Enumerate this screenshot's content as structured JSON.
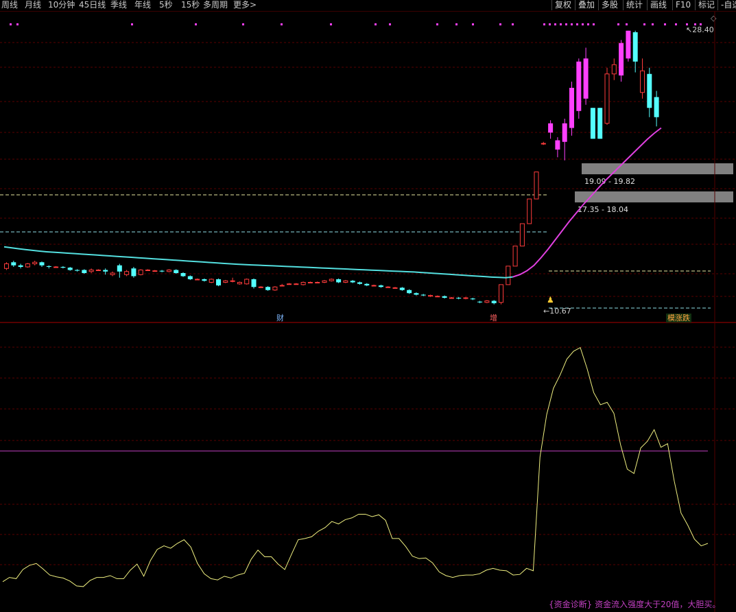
{
  "toolbar": {
    "tabs": [
      "周线",
      "月线",
      "10分钟",
      "45日线",
      "季线",
      "年线",
      "5秒",
      "15秒",
      "多周期",
      "更多>"
    ],
    "buttons": [
      "复权",
      "叠加",
      "多股",
      "统计",
      "画线",
      "F10",
      "标记",
      "-自选"
    ]
  },
  "colors": {
    "up": "#ff3c3c",
    "down": "#54ffff",
    "limit_up": "#ff40ff",
    "ma": "#54e0e0",
    "ma_up": "#e040e0",
    "indicator": "#f0f080",
    "threshold": "#c040c0"
  },
  "labels": {
    "high_price": "28.40",
    "low_price": "10.67",
    "zone1": "19.09 - 19.82",
    "zone2": "17.35 - 18.04",
    "event_cai": "财",
    "event_zeng": "增",
    "event_zhangdie": "模涨跌",
    "footer": "{资金诊断} 资金流入强度大于20值，大胆买。"
  },
  "chart_data": [
    {
      "type": "candlestick",
      "price_range": [
        9.5,
        29.5
      ],
      "marked_high": 28.4,
      "marked_low": 10.67,
      "resistance_zones": [
        [
          19.09,
          19.82
        ],
        [
          17.35,
          18.04
        ]
      ],
      "candles": [
        {
          "o": 13.0,
          "c": 13.3,
          "h": 13.4,
          "l": 12.9
        },
        {
          "o": 13.4,
          "c": 13.2,
          "h": 13.5,
          "l": 13.1
        },
        {
          "o": 13.2,
          "c": 13.1,
          "h": 13.3,
          "l": 13.0
        },
        {
          "o": 13.1,
          "c": 13.3,
          "h": 13.35,
          "l": 13.05
        },
        {
          "o": 13.3,
          "c": 13.4,
          "h": 13.5,
          "l": 13.2
        },
        {
          "o": 13.4,
          "c": 13.2,
          "h": 13.45,
          "l": 13.1
        },
        {
          "o": 13.15,
          "c": 13.1,
          "h": 13.2,
          "l": 13.0
        },
        {
          "o": 13.1,
          "c": 13.1,
          "h": 13.15,
          "l": 13.05
        },
        {
          "o": 13.1,
          "c": 13.05,
          "h": 13.15,
          "l": 13.0
        },
        {
          "o": 13.05,
          "c": 12.9,
          "h": 13.1,
          "l": 12.85
        },
        {
          "o": 12.9,
          "c": 12.85,
          "h": 12.95,
          "l": 12.8
        },
        {
          "o": 12.9,
          "c": 12.7,
          "h": 12.95,
          "l": 12.65
        },
        {
          "o": 12.8,
          "c": 12.9,
          "h": 13.0,
          "l": 12.7
        },
        {
          "o": 12.9,
          "c": 12.9,
          "h": 12.95,
          "l": 12.85
        },
        {
          "o": 12.9,
          "c": 12.8,
          "h": 13.0,
          "l": 12.6
        },
        {
          "o": 12.6,
          "c": 12.7,
          "h": 12.8,
          "l": 12.5
        },
        {
          "o": 13.2,
          "c": 12.8,
          "h": 13.3,
          "l": 12.4
        },
        {
          "o": 12.6,
          "c": 12.8,
          "h": 12.9,
          "l": 12.5
        },
        {
          "o": 13.0,
          "c": 12.5,
          "h": 13.1,
          "l": 12.4
        },
        {
          "o": 12.6,
          "c": 12.9,
          "h": 12.95,
          "l": 12.55
        },
        {
          "o": 12.9,
          "c": 12.9,
          "h": 12.95,
          "l": 12.85
        },
        {
          "o": 12.85,
          "c": 12.85,
          "h": 12.9,
          "l": 12.8
        },
        {
          "o": 12.85,
          "c": 12.8,
          "h": 12.9,
          "l": 12.75
        },
        {
          "o": 12.8,
          "c": 12.9,
          "h": 12.95,
          "l": 12.75
        },
        {
          "o": 12.9,
          "c": 12.7,
          "h": 12.95,
          "l": 12.65
        },
        {
          "o": 12.7,
          "c": 12.5,
          "h": 12.75,
          "l": 12.45
        },
        {
          "o": 12.5,
          "c": 12.3,
          "h": 12.55,
          "l": 12.25
        },
        {
          "o": 12.3,
          "c": 12.3,
          "h": 12.35,
          "l": 12.25
        },
        {
          "o": 12.3,
          "c": 12.2,
          "h": 12.35,
          "l": 12.15
        },
        {
          "o": 12.1,
          "c": 12.3,
          "h": 12.35,
          "l": 12.05
        },
        {
          "o": 12.3,
          "c": 11.9,
          "h": 12.35,
          "l": 11.85
        },
        {
          "o": 12.1,
          "c": 12.2,
          "h": 12.25,
          "l": 12.05
        },
        {
          "o": 12.2,
          "c": 12.2,
          "h": 12.4,
          "l": 12.1
        },
        {
          "o": 12.0,
          "c": 12.1,
          "h": 12.15,
          "l": 11.95
        },
        {
          "o": 12.0,
          "c": 12.3,
          "h": 12.35,
          "l": 11.95
        },
        {
          "o": 12.3,
          "c": 11.8,
          "h": 12.35,
          "l": 11.7
        },
        {
          "o": 11.8,
          "c": 11.8,
          "h": 11.85,
          "l": 11.75
        },
        {
          "o": 11.8,
          "c": 11.6,
          "h": 11.85,
          "l": 11.55
        },
        {
          "o": 11.6,
          "c": 11.8,
          "h": 11.85,
          "l": 11.55
        },
        {
          "o": 11.9,
          "c": 11.9,
          "h": 12.0,
          "l": 11.85
        },
        {
          "o": 12.0,
          "c": 12.0,
          "h": 12.05,
          "l": 11.95
        },
        {
          "o": 12.0,
          "c": 12.0,
          "h": 12.05,
          "l": 11.95
        },
        {
          "o": 11.95,
          "c": 12.1,
          "h": 12.15,
          "l": 11.9
        },
        {
          "o": 12.1,
          "c": 12.1,
          "h": 12.15,
          "l": 12.05
        },
        {
          "o": 12.1,
          "c": 12.1,
          "h": 12.15,
          "l": 12.05
        },
        {
          "o": 12.1,
          "c": 12.2,
          "h": 12.25,
          "l": 12.05
        },
        {
          "o": 12.2,
          "c": 12.3,
          "h": 12.35,
          "l": 12.15
        },
        {
          "o": 12.3,
          "c": 12.1,
          "h": 12.35,
          "l": 12.05
        },
        {
          "o": 12.1,
          "c": 12.2,
          "h": 12.25,
          "l": 12.05
        },
        {
          "o": 12.2,
          "c": 12.1,
          "h": 12.25,
          "l": 12.05
        },
        {
          "o": 12.1,
          "c": 12.0,
          "h": 12.15,
          "l": 11.95
        },
        {
          "o": 12.0,
          "c": 11.9,
          "h": 12.05,
          "l": 11.85
        },
        {
          "o": 11.9,
          "c": 11.9,
          "h": 11.95,
          "l": 11.85
        },
        {
          "o": 11.9,
          "c": 11.8,
          "h": 11.95,
          "l": 11.75
        },
        {
          "o": 11.8,
          "c": 11.8,
          "h": 11.85,
          "l": 11.75
        },
        {
          "o": 11.75,
          "c": 11.75,
          "h": 11.8,
          "l": 11.7
        },
        {
          "o": 11.75,
          "c": 11.6,
          "h": 11.8,
          "l": 11.55
        },
        {
          "o": 11.6,
          "c": 11.4,
          "h": 11.65,
          "l": 11.35
        },
        {
          "o": 11.4,
          "c": 11.3,
          "h": 11.45,
          "l": 11.25
        },
        {
          "o": 11.3,
          "c": 11.25,
          "h": 11.35,
          "l": 11.2
        },
        {
          "o": 11.2,
          "c": 11.25,
          "h": 11.3,
          "l": 11.15
        },
        {
          "o": 11.2,
          "c": 11.2,
          "h": 11.25,
          "l": 11.15
        },
        {
          "o": 11.2,
          "c": 11.1,
          "h": 11.25,
          "l": 11.05
        },
        {
          "o": 11.1,
          "c": 11.1,
          "h": 11.15,
          "l": 11.05
        },
        {
          "o": 11.1,
          "c": 11.05,
          "h": 11.15,
          "l": 11.0
        },
        {
          "o": 11.05,
          "c": 11.1,
          "h": 11.15,
          "l": 11.0
        },
        {
          "o": 11.05,
          "c": 11.0,
          "h": 11.1,
          "l": 10.95
        },
        {
          "o": 10.85,
          "c": 10.8,
          "h": 10.9,
          "l": 10.75
        },
        {
          "o": 10.8,
          "c": 10.9,
          "h": 10.95,
          "l": 10.75
        },
        {
          "o": 10.9,
          "c": 10.75,
          "h": 10.95,
          "l": 10.67
        },
        {
          "o": 10.8,
          "c": 11.95,
          "h": 11.95,
          "l": 10.67
        },
        {
          "o": 11.95,
          "c": 13.15,
          "h": 13.15,
          "l": 11.95
        },
        {
          "o": 13.15,
          "c": 14.45,
          "h": 14.45,
          "l": 13.15
        },
        {
          "o": 14.45,
          "c": 15.9,
          "h": 15.9,
          "l": 14.45
        },
        {
          "o": 15.9,
          "c": 17.5,
          "h": 17.5,
          "l": 15.9
        },
        {
          "o": 17.5,
          "c": 19.25,
          "h": 19.25,
          "l": 17.5
        },
        {
          "o": 21.1,
          "c": 21.1,
          "h": 21.2,
          "l": 21.0
        },
        {
          "o": 22.4,
          "c": 21.8,
          "h": 22.6,
          "l": 21.4
        },
        {
          "o": 20.7,
          "c": 21.3,
          "h": 21.5,
          "l": 20.2
        },
        {
          "o": 21.2,
          "c": 22.4,
          "h": 22.7,
          "l": 20.0
        },
        {
          "o": 22.1,
          "c": 24.7,
          "h": 25.1,
          "l": 21.6
        },
        {
          "o": 23.2,
          "c": 26.4,
          "h": 26.6,
          "l": 22.7
        },
        {
          "o": 24.0,
          "c": 26.6,
          "h": 27.3,
          "l": 23.6
        },
        {
          "o": 23.4,
          "c": 21.4,
          "h": 23.4,
          "l": 21.4
        },
        {
          "o": 23.4,
          "c": 21.4,
          "h": 23.4,
          "l": 21.4
        },
        {
          "o": 22.4,
          "c": 25.6,
          "h": 26.0,
          "l": 22.3
        },
        {
          "o": 25.6,
          "c": 26.2,
          "h": 26.6,
          "l": 25.2
        },
        {
          "o": 25.5,
          "c": 27.6,
          "h": 27.8,
          "l": 25.1
        },
        {
          "o": 26.6,
          "c": 28.4,
          "h": 28.4,
          "l": 26.4
        },
        {
          "o": 28.3,
          "c": 26.4,
          "h": 28.4,
          "l": 25.7
        },
        {
          "o": 24.4,
          "c": 25.8,
          "h": 26.6,
          "l": 24.0
        },
        {
          "o": 25.6,
          "c": 23.4,
          "h": 26.0,
          "l": 22.8
        },
        {
          "o": 24.1,
          "c": 22.8,
          "h": 24.5,
          "l": 22.2
        }
      ],
      "moving_average": [
        14.4,
        14.34,
        14.28,
        14.22,
        14.17,
        14.12,
        14.08,
        14.05,
        14.02,
        13.99,
        13.96,
        13.93,
        13.9,
        13.87,
        13.84,
        13.81,
        13.78,
        13.75,
        13.72,
        13.69,
        13.66,
        13.63,
        13.6,
        13.57,
        13.54,
        13.51,
        13.48,
        13.45,
        13.42,
        13.39,
        13.36,
        13.33,
        13.3,
        13.27,
        13.25,
        13.23,
        13.21,
        13.19,
        13.17,
        13.15,
        13.13,
        13.11,
        13.09,
        13.07,
        13.05,
        13.03,
        13.01,
        12.99,
        12.97,
        12.95,
        12.93,
        12.91,
        12.89,
        12.87,
        12.85,
        12.83,
        12.81,
        12.79,
        12.77,
        12.74,
        12.71,
        12.68,
        12.65,
        12.62,
        12.59,
        12.56,
        12.53,
        12.5,
        12.47,
        12.44,
        12.42,
        12.4,
        12.45,
        12.6,
        12.85,
        13.2,
        13.7,
        14.25,
        14.85,
        15.45,
        16.05,
        16.6,
        17.15,
        17.65,
        18.15,
        18.65,
        19.1,
        19.55,
        20.0,
        20.45,
        20.9,
        21.35,
        21.75,
        22.1
      ]
    },
    {
      "type": "line",
      "title": "资金诊断",
      "threshold": 20,
      "value_range": [
        -4,
        40
      ],
      "values": [
        -1.5,
        -0.8,
        -1.0,
        0.5,
        1.2,
        1.5,
        0.6,
        -0.4,
        -0.7,
        -0.9,
        -1.4,
        -2.2,
        -2.3,
        -1.3,
        -0.8,
        -0.8,
        -0.5,
        -1.0,
        -1.0,
        0.4,
        1.4,
        -0.6,
        2.0,
        3.8,
        4.4,
        4.0,
        4.8,
        5.4,
        4.2,
        1.5,
        -0.2,
        -1.0,
        -1.2,
        -0.6,
        -0.9,
        -0.4,
        -0.1,
        2.2,
        3.7,
        2.6,
        2.6,
        1.4,
        0.5,
        3.0,
        5.4,
        5.6,
        5.9,
        6.8,
        7.4,
        8.4,
        8.0,
        8.7,
        9.0,
        9.6,
        9.6,
        9.2,
        9.5,
        8.6,
        5.6,
        5.6,
        4.3,
        2.7,
        2.3,
        2.4,
        1.6,
        0.1,
        -0.5,
        -0.8,
        -0.5,
        -0.4,
        -0.4,
        -0.2,
        0.4,
        0.7,
        0.4,
        0.3,
        -0.4,
        -0.3,
        0.7,
        0.3,
        19.0,
        26.0,
        30.3,
        32.5,
        35.1,
        36.4,
        37.0,
        33.6,
        29.6,
        27.6,
        28.0,
        26.2,
        21.0,
        17.0,
        16.3,
        20.5,
        21.6,
        23.5,
        20.6,
        21.2,
        15.0,
        9.8,
        7.8,
        5.5,
        4.4,
        4.8
      ]
    }
  ]
}
